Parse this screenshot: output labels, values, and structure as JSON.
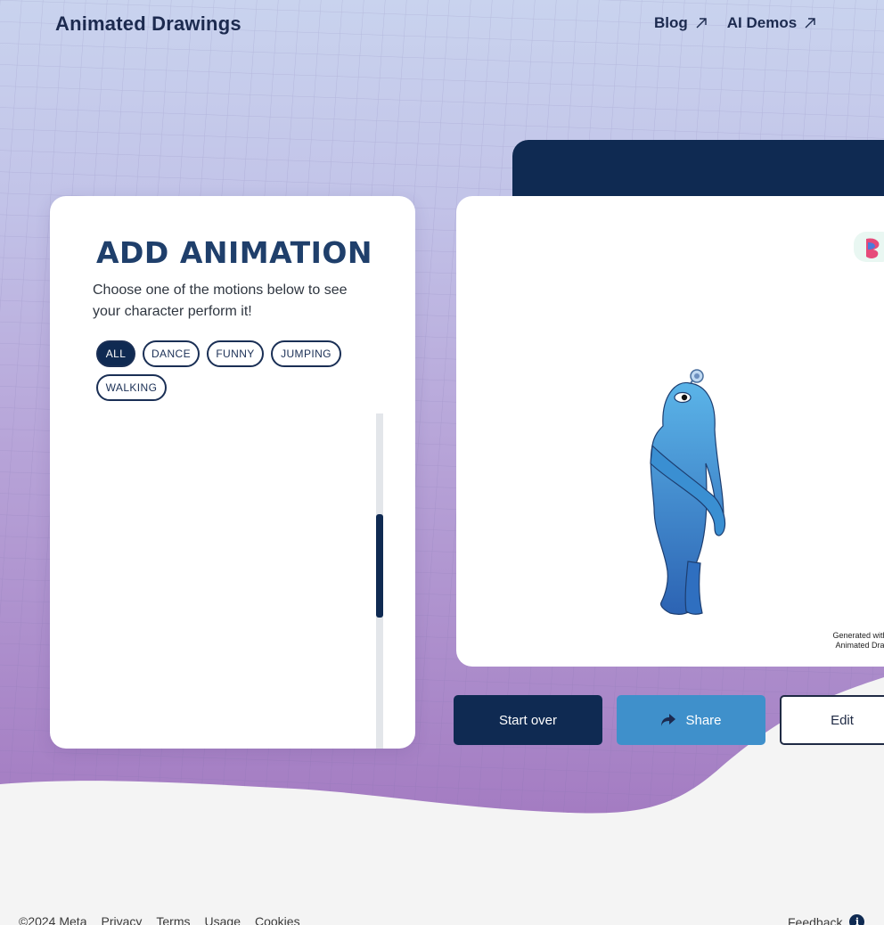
{
  "header": {
    "brand": "Animated Drawings",
    "nav": [
      {
        "label": "Blog"
      },
      {
        "label": "AI Demos"
      }
    ]
  },
  "panel": {
    "title": "ADD ANIMATION",
    "description": "Choose one of the motions below to see your character perform it!",
    "filters": [
      {
        "label": "ALL",
        "active": true
      },
      {
        "label": "DANCE",
        "active": false
      },
      {
        "label": "FUNNY",
        "active": false
      },
      {
        "label": "JUMPING",
        "active": false
      },
      {
        "label": "WALKING",
        "active": false
      }
    ],
    "motions_selected_index": 4
  },
  "preview": {
    "watermark_line1": "Generated with",
    "watermark_line2": "Animated Dra"
  },
  "actions": {
    "start_over": "Start over",
    "share": "Share",
    "edit": "Edit"
  },
  "footer": {
    "links": [
      "©2024 Meta",
      "Privacy",
      "Terms",
      "Usage",
      "Cookies"
    ],
    "feedback": "Feedback"
  },
  "colors": {
    "navy": "#0f2a52",
    "share_blue": "#3f90cb",
    "selected_border": "#4392c8"
  }
}
